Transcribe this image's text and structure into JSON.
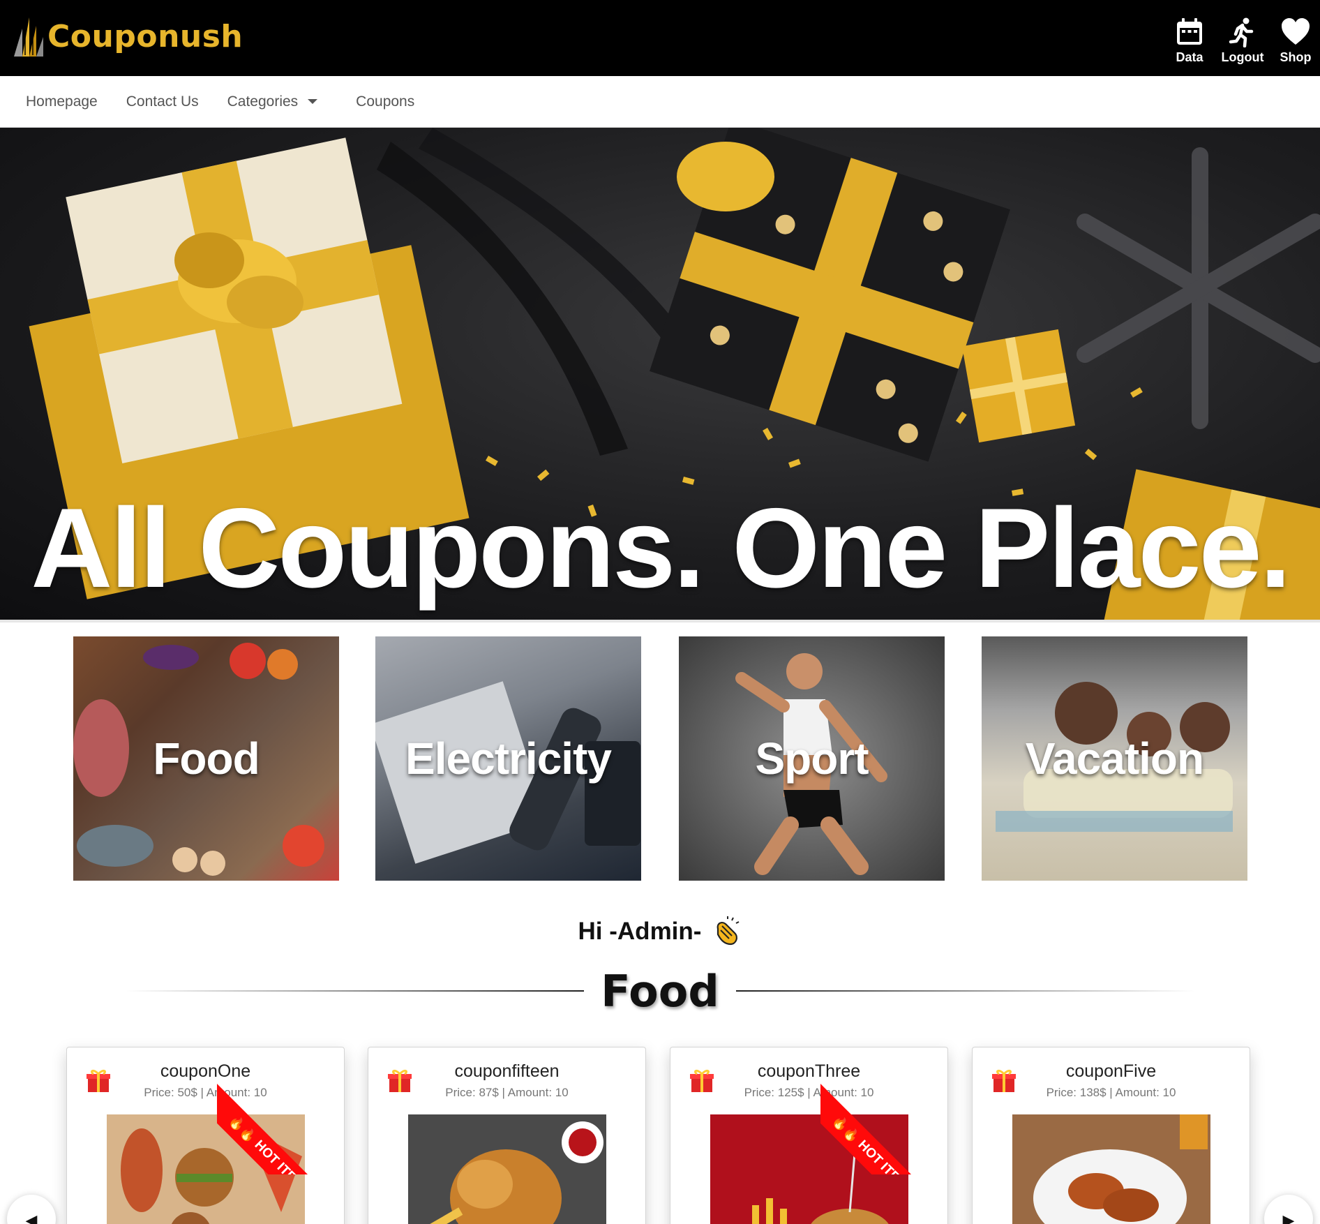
{
  "brand": {
    "name": "Couponush",
    "accent": "#e7b52c"
  },
  "top_icons": [
    {
      "label": "Data",
      "icon": "calendar-icon"
    },
    {
      "label": "Logout",
      "icon": "running-person-icon"
    },
    {
      "label": "Shop",
      "icon": "heart-icon"
    }
  ],
  "nav": {
    "homepage": "Homepage",
    "contact": "Contact Us",
    "categories": "Categories",
    "coupons": "Coupons"
  },
  "hero": {
    "title": "All Coupons. One Place."
  },
  "categories": [
    {
      "label": "Food"
    },
    {
      "label": "Electricity"
    },
    {
      "label": "Sport"
    },
    {
      "label": "Vacation"
    }
  ],
  "greeting": "Hi -Admin-",
  "section_title": "Food",
  "coupons": [
    {
      "name": "couponOne",
      "meta": "Price: 50$ | Amount: 10",
      "hot": true
    },
    {
      "name": "couponfifteen",
      "meta": "Price: 87$ | Amount: 10",
      "hot": false
    },
    {
      "name": "couponThree",
      "meta": "Price: 125$ | Amount: 10",
      "hot": true
    },
    {
      "name": "couponFive",
      "meta": "Price: 138$ | Amount: 10",
      "hot": false
    }
  ],
  "ribbon_label": "HOT ITEM",
  "carousel": {
    "prev": "◀",
    "next": "▶"
  }
}
